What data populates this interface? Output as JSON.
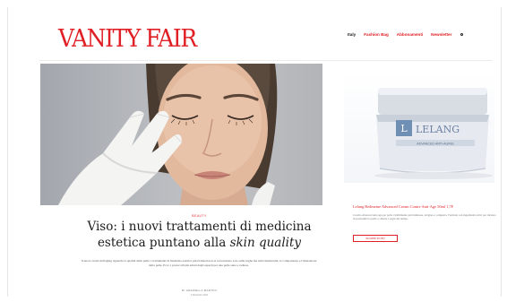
{
  "brand": {
    "logo": "VANITY FAIR",
    "accent": "#e01f25"
  },
  "nav": {
    "items": [
      "Italy",
      "Fashion Bag",
      "Abbonamenti",
      "Newsletter"
    ],
    "search_icon": "search-icon"
  },
  "hero_image": {
    "subject": "woman-face-treatment"
  },
  "ad": {
    "product": {
      "brand": "LELANG",
      "initial": "L",
      "sublabel": "ADVANCED ANTI-AGING"
    },
    "title": "Lelang Redmeine Advanced Cream Contre Anti-Age 50ml 1,7F",
    "text": "Cream advanced anti-age per pelle visibilmente più luminosa, levigata e compatta. Formula con ingredienti attivi per idratare in profondità la pelle e ridurre i segni del tempo.",
    "button": "SCOPRI DI PIÙ"
  },
  "article": {
    "category": "BEAUTY",
    "headline_line1": "Viso: i nuovi trattamenti di medicina",
    "headline_line2_prefix": "estetica puntano alla ",
    "headline_italic": "skin quality",
    "standfirst": "Il nuovo trend dell'aging riguarda la qualità della pelle: i trattamenti di medicina estetica più richiesti non si concentrano solo sulle rughe ma sulla luminosità, la compattezza e l'idratazione della pelle. Ecco i protocolli più amati dagli esperti per una pelle sana e radiosa.",
    "byline": "DI GRAZIELLA MARTINI",
    "date": "3 MAGGIO 2023"
  }
}
